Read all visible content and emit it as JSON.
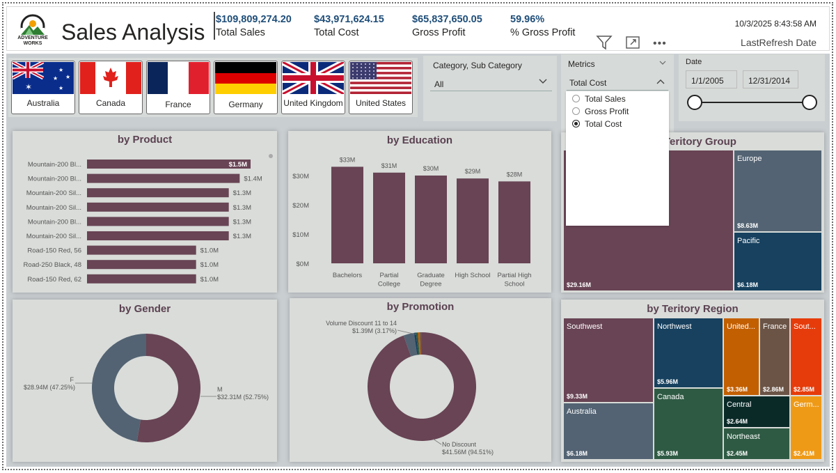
{
  "header": {
    "logo_text": "ADVENTURE WORKS",
    "title": "Sales Analysis",
    "kpis": [
      {
        "value": "$109,809,274.20",
        "label": "Total Sales"
      },
      {
        "value": "$43,971,624.15",
        "label": "Total Cost"
      },
      {
        "value": "$65,837,650.05",
        "label": "Gross Profit"
      },
      {
        "value": "59.96%",
        "label": "% Gross Profit"
      }
    ],
    "refresh_value": "10/3/2025 8:43:58 AM",
    "refresh_label": "LastRefresh Date"
  },
  "flags": [
    "Australia",
    "Canada",
    "France",
    "Germany",
    "United Kingdom",
    "United States"
  ],
  "category_slicer": {
    "label": "Category, Sub Category",
    "value": "All"
  },
  "metrics_slicer": {
    "label": "Metrics",
    "value": "Total Cost",
    "options": [
      "Total Sales",
      "Gross Profit",
      "Total Cost"
    ],
    "selected": "Total Cost"
  },
  "date_slicer": {
    "label": "Date",
    "start": "1/1/2005",
    "end": "12/31/2014"
  },
  "colors": {
    "maroon": "#684454",
    "slate": "#536373",
    "navy": "#17415f",
    "teal": "#2e5a43",
    "orange": "#c25f00",
    "brown": "#6b5446",
    "red": "#e63c0b",
    "dark": "#0a2a28",
    "gold": "#ef9a17"
  },
  "charts": {
    "product": {
      "title": "by Product",
      "chart_data": {
        "type": "bar",
        "orientation": "horizontal",
        "categories": [
          "Mountain-200 Bl...",
          "Mountain-200 Bl...",
          "Mountain-200 Sil...",
          "Mountain-200 Sil...",
          "Mountain-200 Bl...",
          "Mountain-200 Sil...",
          "Road-150 Red, 56",
          "Road-250 Black, 48",
          "Road-150 Red, 62"
        ],
        "values": [
          1.5,
          1.4,
          1.3,
          1.3,
          1.3,
          1.3,
          1.0,
          1.0,
          1.0
        ],
        "labels": [
          "$1.5M",
          "$1.4M",
          "$1.3M",
          "$1.3M",
          "$1.3M",
          "$1.3M",
          "$1.0M",
          "$1.0M",
          "$1.0M"
        ]
      }
    },
    "education": {
      "title": "by Education",
      "chart_data": {
        "type": "bar",
        "categories": [
          "Bachelors",
          "Partial College",
          "Graduate Degree",
          "High School",
          "Partial High School"
        ],
        "values": [
          33,
          31,
          30,
          29,
          28
        ],
        "labels": [
          "$33M",
          "$31M",
          "$30M",
          "$29M",
          "$28M"
        ],
        "yticks": [
          "$0M",
          "$10M",
          "$20M",
          "$30M"
        ],
        "ylim": [
          0,
          35
        ]
      }
    },
    "gender": {
      "title": "by Gender",
      "chart_data": {
        "type": "pie",
        "donut": true,
        "slices": [
          {
            "name": "M",
            "value": 32.31,
            "label": "$32.31M (52.75%)"
          },
          {
            "name": "F",
            "value": 28.94,
            "label": "$28.94M (47.25%)"
          }
        ]
      }
    },
    "promotion": {
      "title": "by Promotion",
      "chart_data": {
        "type": "pie",
        "donut": true,
        "slices": [
          {
            "name": "No Discount",
            "value": 41.56,
            "label": "$41.56M (94.51%)"
          },
          {
            "name": "Volume Discount 11 to 14",
            "value": 1.39,
            "label": "$1.39M (3.17%)"
          }
        ]
      }
    },
    "territory_group": {
      "title": "Teritory Group",
      "chart_data": {
        "type": "treemap",
        "items": [
          {
            "name": "",
            "value": 29.16,
            "label": "$29.16M"
          },
          {
            "name": "Europe",
            "value": 8.63,
            "label": "$8.63M"
          },
          {
            "name": "Pacific",
            "value": 6.18,
            "label": "$6.18M"
          }
        ]
      }
    },
    "territory_region": {
      "title": "by Teritory Region",
      "chart_data": {
        "type": "treemap",
        "items": [
          {
            "name": "Southwest",
            "label": "$9.33M"
          },
          {
            "name": "Australia",
            "label": "$6.18M"
          },
          {
            "name": "Northwest",
            "label": "$5.96M"
          },
          {
            "name": "Canada",
            "label": "$5.93M"
          },
          {
            "name": "United...",
            "label": "$3.36M"
          },
          {
            "name": "France",
            "label": "$2.86M"
          },
          {
            "name": "Sout...",
            "label": "$2.85M"
          },
          {
            "name": "Central",
            "label": "$2.64M"
          },
          {
            "name": "Northeast",
            "label": "$2.45M"
          },
          {
            "name": "Germ...",
            "label": "$2.41M"
          }
        ]
      }
    }
  }
}
